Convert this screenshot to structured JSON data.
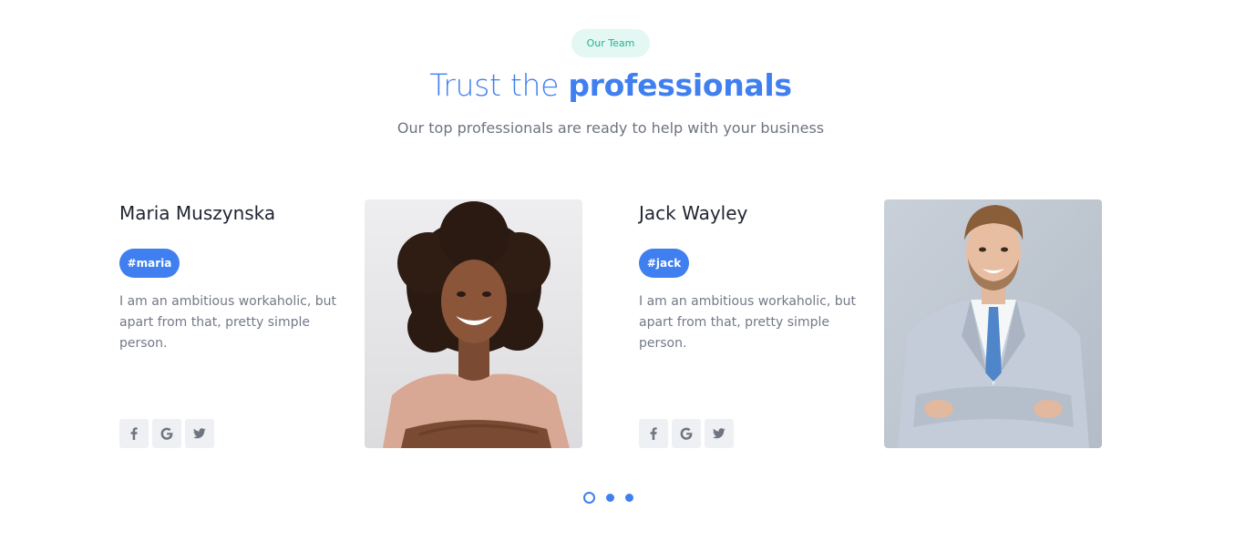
{
  "section": {
    "badge": "Our Team",
    "title_light": "Trust the",
    "title_bold": "professionals",
    "subtitle": "Our top professionals are ready to help with your business"
  },
  "members": [
    {
      "name": "Maria Muszynska",
      "tag": "#maria",
      "bio": "I am an ambitious workaholic, but apart from that, pretty simple person.",
      "socials": [
        "facebook-icon",
        "google-icon",
        "twitter-icon"
      ]
    },
    {
      "name": "Jack Wayley",
      "tag": "#jack",
      "bio": "I am an ambitious workaholic, but apart from that, pretty simple person.",
      "socials": [
        "facebook-icon",
        "google-icon",
        "twitter-icon"
      ]
    }
  ],
  "carousel": {
    "pages": 3,
    "active": 1
  },
  "colors": {
    "accent": "#3f7ff0",
    "badge_bg": "#e3f7f3",
    "badge_text": "#22b590",
    "body_text": "#737986"
  }
}
